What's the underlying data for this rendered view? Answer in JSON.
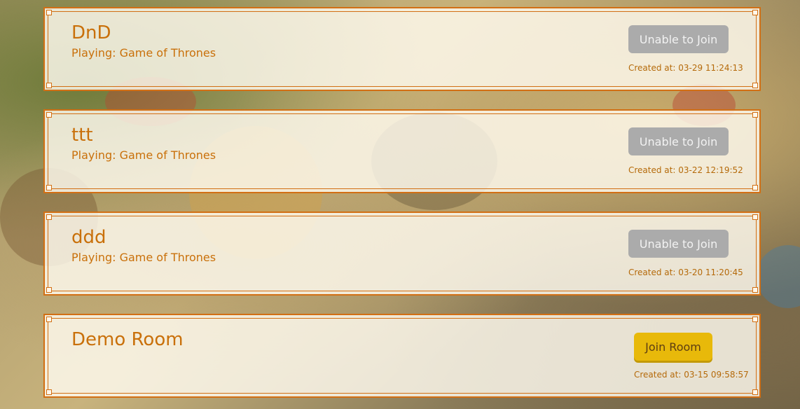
{
  "rooms": [
    {
      "name": "DnD",
      "playing": "Playing: Game of Thrones",
      "button_label": "Unable to Join",
      "created": "Created at: 03-29 11:24:13"
    },
    {
      "name": "ttt",
      "playing": "Playing: Game of Thrones",
      "button_label": "Unable to Join",
      "created": "Created at: 03-22 12:19:52"
    },
    {
      "name": "ddd",
      "playing": "Playing: Game of Thrones",
      "button_label": "Unable to Join",
      "created": "Created at: 03-20 11:20:45"
    },
    {
      "name": "Demo Room",
      "playing": "",
      "button_label": "Join Room",
      "created": "Created at: 03-15 09:58:57"
    }
  ],
  "colors": {
    "border": "#d26f14",
    "text": "#c9700a",
    "button_disabled": "#ababab",
    "button_join": "#e8b90a"
  }
}
